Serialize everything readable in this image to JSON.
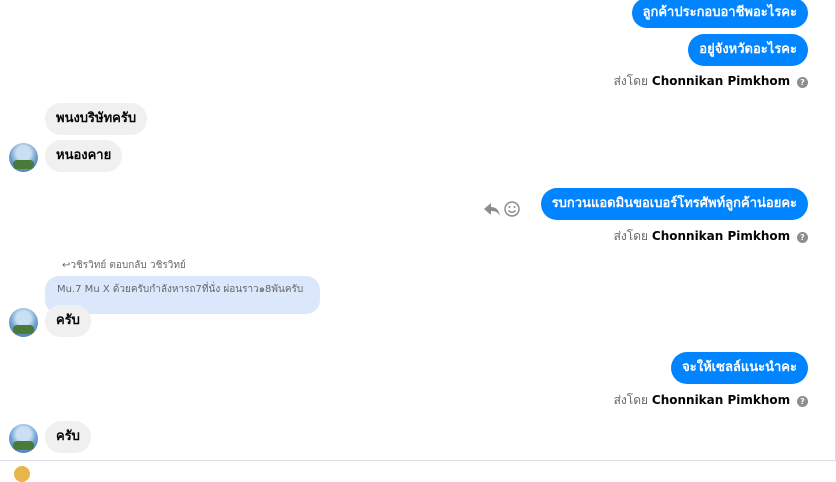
{
  "messages": {
    "out1": "ลูกค้าประกอบอาชีพอะไรคะ",
    "out2": "อยู่จังหวัดอะไรคะ",
    "in1": "พนงบริษัทครับ",
    "in2": "หนองคาย",
    "out3": "รบกวนแอดมินขอเบอร์โทรศัพท์ลูกค้าน่อยคะ",
    "reply_meta": "↩วชิรวิทย์ ตอบกลับ วชิรวิทย์",
    "quoted_text": "Mu.7 Mu X ด้วยครับกำลังหารถ7ที่นั่ง ผ่อนราว๑8พันครับ",
    "in3": "ครับ",
    "out4": "จะให้เซลล์แนะนำคะ",
    "in4": "ครับ"
  },
  "sent_by": {
    "prefix": "ส่งโดย",
    "name": "Chonnikan Pimkhom",
    "help_glyph": "?"
  },
  "icons": {
    "reply": "reply-arrow-icon",
    "emoji": "smiley-icon",
    "help": "question-circle-icon"
  },
  "colors": {
    "outgoing_bubble": "#0084ff",
    "incoming_bubble": "#f0f0f0",
    "quoted_bubble": "#dbe8fb"
  }
}
